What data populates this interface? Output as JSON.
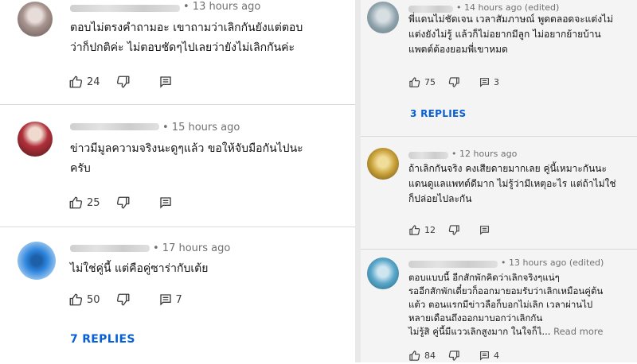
{
  "left_comments": [
    {
      "time": "• 13 hours ago",
      "text_lines": [
        "ตอบไม่ตรงคำถามอะ เขาถามว่าเลิกกันยังแต่ตอบ",
        "ว่าก็ปกติค่ะ ไม่ตอบชัดๆไปเลยว่ายังไม่เลิกกันค่ะ"
      ],
      "likes": "24",
      "reply_count": "",
      "avatar_color": "#b7a6a3"
    },
    {
      "time": "• 15 hours ago",
      "text_lines": [
        "ข่าวมีมูลความจริงนะดูๆแล้ว ขอให้จับมือกันไปนะ",
        "ครับ"
      ],
      "likes": "25",
      "reply_count": "",
      "avatar_color": "#b0303a"
    },
    {
      "time": "• 17 hours ago",
      "text_lines": [
        "ไม่ใช่คู่นี้  แต่คือคู่ซาร่ากับเต้ย"
      ],
      "likes": "50",
      "reply_count": "7",
      "replies_label": "7 REPLIES",
      "avatar_color": "#2e86de"
    }
  ],
  "right_comments": [
    {
      "time": "• 14 hours ago (edited)",
      "text_lines": [
        "พี่แดนไม่ชัดเจน เวลาสัมภาษณ์ พูดตลอดจะแต่งไม่",
        "แต่งยังไม่รู้ แล้วก็ไม่อยากมีลูก ไม่อยากย้ายบ้าน",
        "แพตต์ต้องยอมพี่เขาหมด"
      ],
      "likes": "75",
      "reply_count": "3",
      "replies_label": "3 REPLIES",
      "avatar_color": "#8fa3ad"
    },
    {
      "time": "• 12 hours ago",
      "text_lines": [
        "ถ้าเลิกกันจริง คงเสียดายมากเลย คู่นี้เหมาะกันนะ",
        "แดนดูแลแพทต์ดีมาก ไม่รู้ว่ามีเหตุอะไร แต่ถ้าไม่ใช่",
        "ก็ปล่อยไปละกัน"
      ],
      "likes": "12",
      "reply_count": "",
      "avatar_color": "#c9a23a"
    },
    {
      "time": "• 13 hours ago (edited)",
      "text_lines": [
        "ตอบแบบนี้ อีกสักพักคิดว่าเลิกจริงๆแน่ๆ",
        "รออีกสักพักเดี๋ยวก็ออกมายอมรับว่าเลิกเหมือนคู่ต้น",
        "แต้ว ตอนแรกมีข่าวลือก็บอกไม่เลิก เวลาผ่านไป",
        "หลายเดือนถึงออกมาบอกว่าเลิกกัน",
        "ไม่รู้สิ คู่นี้มีแววเลิกสูงมาก  ในใจก็ไ..."
      ],
      "read_more": "Read more",
      "likes": "84",
      "reply_count": "4",
      "avatar_color": "#5aa7c9"
    }
  ],
  "icons": {
    "like": "thumbs-up-icon",
    "dislike": "thumbs-down-icon",
    "reply": "comment-icon"
  }
}
